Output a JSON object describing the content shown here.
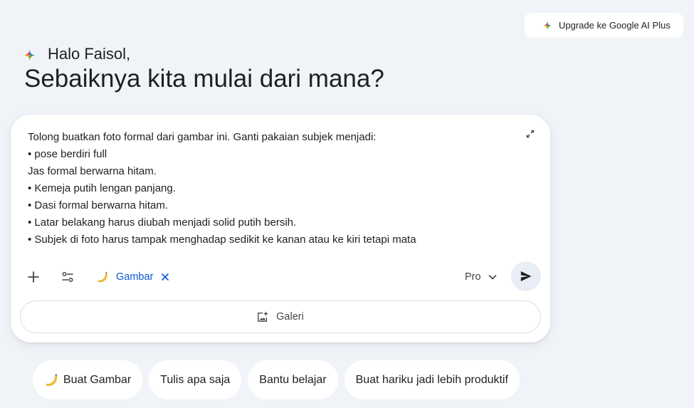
{
  "colors": {
    "page_background": "#f0f4f9",
    "surface": "#ffffff",
    "text": "#1f1f1f",
    "muted_text": "#444746",
    "accent": "#0b57d0",
    "send_button_bg": "#e9eef6"
  },
  "icons": {
    "upgrade": "gemini-sparkle-icon",
    "greeting": "gemini-sparkle-icon",
    "expand": "expand-icon",
    "add": "plus-icon",
    "tools": "tools-icon",
    "selected_tool": "banana-icon",
    "selected_tool_remove": "close-icon",
    "model_menu": "chevron-down-icon",
    "send": "send-icon",
    "gallery": "add-photo-icon",
    "suggestion_image": "banana-icon"
  },
  "header": {
    "upgrade_label": "Upgrade ke Google AI Plus"
  },
  "greeting": {
    "hello": "Halo Faisol,",
    "title": "Sebaiknya kita mulai dari mana?"
  },
  "prompt": {
    "lines": [
      "Tolong buatkan foto formal dari gambar ini. Ganti pakaian subjek menjadi:",
      "• pose berdiri full",
      "Jas formal berwarna hitam.",
      "• Kemeja putih lengan panjang.",
      "• Dasi formal berwarna hitam.",
      "• Latar belakang harus diubah menjadi solid putih bersih.",
      "• Subjek di foto harus tampak menghadap sedikit ke kanan atau ke kiri tetapi mata"
    ]
  },
  "toolbar": {
    "tool_chip_label": "Gambar",
    "model_label": "Pro"
  },
  "gallery": {
    "label": "Galeri"
  },
  "suggestions": [
    {
      "label": "Buat Gambar"
    },
    {
      "label": "Tulis apa saja"
    },
    {
      "label": "Bantu belajar"
    },
    {
      "label": "Buat hariku jadi lebih produktif"
    }
  ]
}
